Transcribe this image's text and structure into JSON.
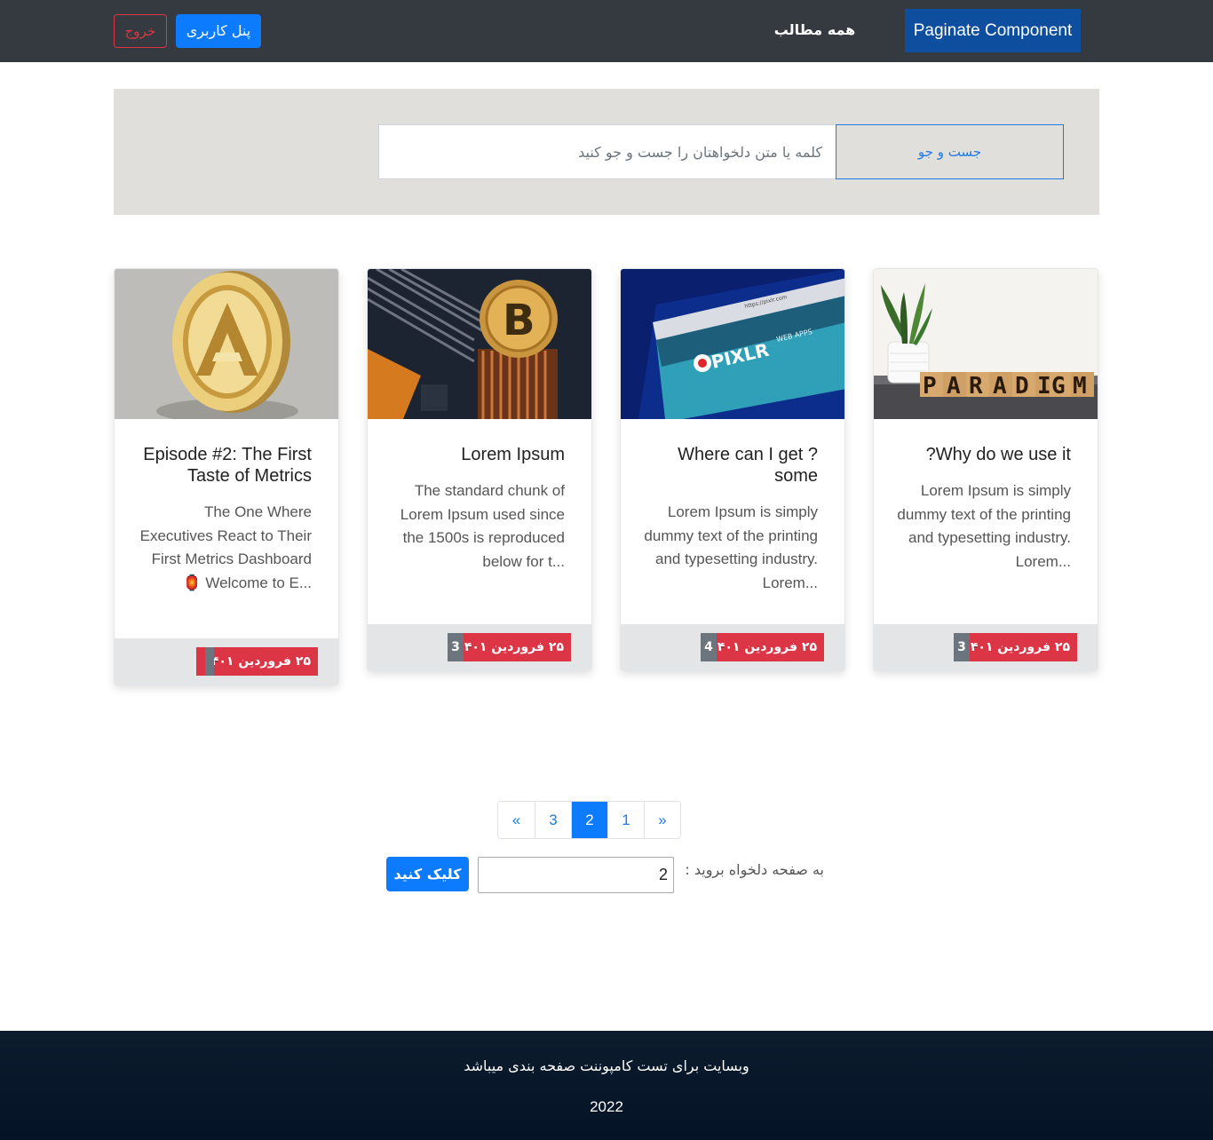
{
  "navbar": {
    "brand": "Paginate Component",
    "all_posts": "همه مطالب",
    "user_panel": "پنل کاربری",
    "logout": "خروج"
  },
  "search": {
    "button_label": "جست و جو",
    "placeholder": "کلمه یا متن دلخواهتان را جست و جو کنید"
  },
  "cards": [
    {
      "image_icon": "paradigm-blocks-image",
      "title": "?Why do we use it",
      "text": "Lorem Ipsum is simply dummy text of the printing and typesetting industry. Lorem...",
      "date": "۲۵ فروردین ۱۴۰۱",
      "separator": "-",
      "count": "3"
    },
    {
      "image_icon": "pixlr-browser-image",
      "title": "Where can I get ?some",
      "text": "Lorem Ipsum is simply dummy text of the printing and typesetting industry. Lorem...",
      "date": "۲۵ فروردین ۱۴۰۱",
      "separator": "-",
      "count": "4"
    },
    {
      "image_icon": "bitcoin-image",
      "title": "Lorem Ipsum",
      "text": "The standard chunk of Lorem Ipsum used since the 1500s is reproduced below for t...",
      "date": "۲۵ فروردین ۱۴۰۱",
      "separator": "-",
      "count": "3"
    },
    {
      "image_icon": "gold-coin-image",
      "title": "Episode #2: The First Taste of Metrics",
      "text": "The One Where Executives React to Their First Metrics Dashboard 🏮 Welcome to E...",
      "date": "۲۵ فروردین ۱۴۰۱",
      "separator": "-",
      "count": ""
    }
  ],
  "pagination": {
    "prev": "«",
    "pages": [
      "3",
      "2",
      "1"
    ],
    "next": "»",
    "active_page": "2"
  },
  "goto": {
    "label": "به صفحه دلخواه بروید :",
    "value": "2",
    "button": "کلیک کنید"
  },
  "footer": {
    "text": "وبسایت برای تست کامپوننت صفحه بندی میباشد",
    "year": "2022"
  }
}
